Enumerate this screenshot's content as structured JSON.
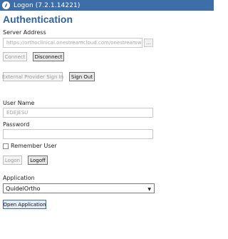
{
  "window": {
    "title": "Logon (7.2.1.14221)",
    "accent": "#3d6ea8"
  },
  "heading": "Authentication",
  "server": {
    "label": "Server Address",
    "value": "https://orthoclinical.onestreamcloud.com/onestreamweb",
    "browse_label": "...",
    "connect_label": "Connect",
    "disconnect_label": "Disconnect"
  },
  "external": {
    "signin_label": "External Provider Sign In",
    "signout_label": "Sign Out"
  },
  "user": {
    "username_label": "User Name",
    "username_value": "EDEJESU",
    "password_label": "Password",
    "password_value": "",
    "remember_label": "Remember User",
    "logon_label": "Logon",
    "logoff_label": "Logoff"
  },
  "application": {
    "label": "Application",
    "selected": "QuidelOrtho",
    "open_label": "Open Application"
  }
}
